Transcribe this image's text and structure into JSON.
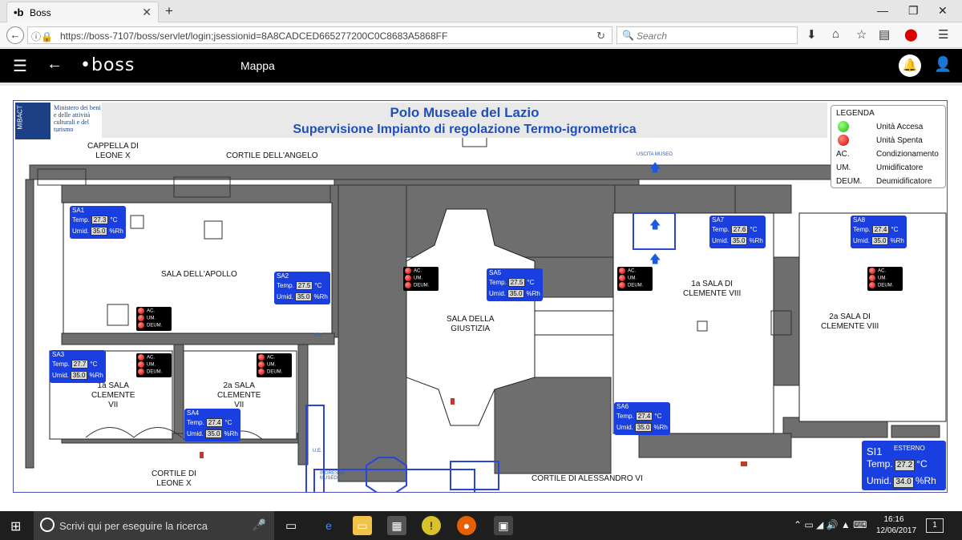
{
  "browser": {
    "tab_title": "Boss",
    "tab_favicon": "•b",
    "new_tab": "+",
    "url": "https://boss-7107/boss/servlet/login;jsessionid=8A8CADCED665277200C0C8683A5868FF",
    "search_placeholder": "Search"
  },
  "app": {
    "logo": "•boss",
    "page_title": "Mappa"
  },
  "map": {
    "title_line1": "Polo Museale del Lazio",
    "title_line2": "Supervisione Impianto di regolazione Termo-igrometrica",
    "mibact": {
      "vertical": "MIBACT",
      "text": "Ministero dei beni e delle attività culturali e del turismo"
    },
    "legend": {
      "title": "LEGENDA",
      "items": [
        {
          "key": "",
          "label": "Unità Accesa",
          "color": "#1db81b"
        },
        {
          "key": "",
          "label": "Unità Spenta",
          "color": "#d40000"
        },
        {
          "key": "AC.",
          "label": "Condizionamento"
        },
        {
          "key": "UM.",
          "label": "Umidificatore"
        },
        {
          "key": "DEUM.",
          "label": "Deumidificatore"
        }
      ]
    },
    "rooms": {
      "cappella": "CAPPELLA DI\nLEONE X",
      "cortile_angelo": "CORTILE DELL'ANGELO",
      "sala_apollo": "SALA DELL'APOLLO",
      "sala_giustizia": "SALA DELLA\nGIUSTIZIA",
      "sala1_clemente_viii": "1a SALA DI\nCLEMENTE VIII",
      "sala2_clemente_viii": "2a SALA DI\nCLEMENTE VIII",
      "sala1_clemente_vii": "1a SALA\nCLEMENTE\nVII",
      "sala2_clemente_vii": "2a SALA\nCLEMENTE\nVII",
      "cortile_leone": "CORTILE DI\nLEONE X",
      "cortile_alessandro": "CORTILE DI ALESSANDRO VI",
      "uscita_museo": "USCITA MUSEO",
      "ingresso_museo": "INGRESSO\nMUSEO",
      "ue1": "U.E.",
      "ue2": "U.E."
    },
    "sensor_labels": {
      "temp": "Temp.",
      "umid": "Umid.",
      "temp_unit": "°C",
      "umid_unit": "%Rh"
    },
    "sensors": [
      {
        "id": "SA1",
        "temp": "27.3",
        "umid": "35.0"
      },
      {
        "id": "SA2",
        "temp": "27.5",
        "umid": "35.0"
      },
      {
        "id": "SA3",
        "temp": "27.7",
        "umid": "35.0"
      },
      {
        "id": "SA4",
        "temp": "27.4",
        "umid": "35.0"
      },
      {
        "id": "SA5",
        "temp": "27.5",
        "umid": "35.0"
      },
      {
        "id": "SA6",
        "temp": "27.4",
        "umid": "35.0"
      },
      {
        "id": "SA7",
        "temp": "27.6",
        "umid": "35.0"
      },
      {
        "id": "SA8",
        "temp": "27.4",
        "umid": "35.0"
      }
    ],
    "status_labels": {
      "ac": "AC.",
      "um": "UM.",
      "deum": "DEUM."
    },
    "external": {
      "id": "SI1",
      "tag": "ESTERNO",
      "temp": "27.2",
      "umid": "34.0"
    }
  },
  "taskbar": {
    "search_placeholder": "Scrivi qui per eseguire la ricerca",
    "time": "16:16",
    "date": "12/06/2017",
    "notifications": "1"
  }
}
